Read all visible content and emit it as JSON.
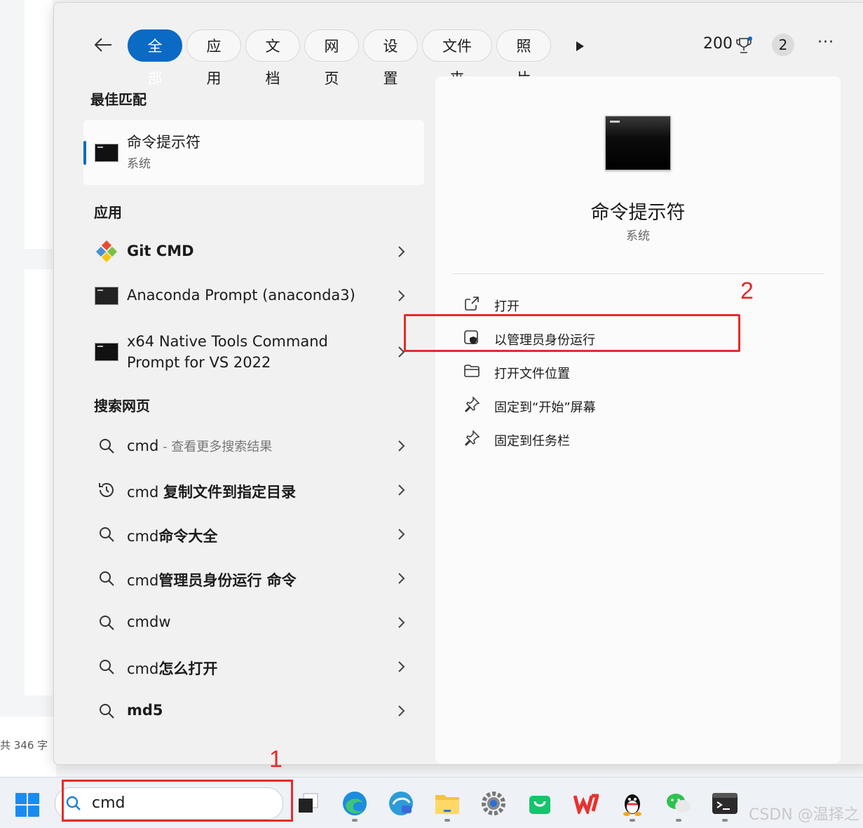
{
  "background": {
    "word_count": "共 346 字"
  },
  "header": {
    "tabs": [
      "全部",
      "应用",
      "文档",
      "网页",
      "设置",
      "文件夹",
      "照片"
    ],
    "points": "200",
    "badge": "2",
    "more": "···"
  },
  "best_match": {
    "section": "最佳匹配",
    "title": "命令提示符",
    "subtitle": "系统"
  },
  "apps": {
    "section": "应用",
    "items": [
      {
        "label": "Git CMD",
        "icon": "git-icon"
      },
      {
        "label": "Anaconda Prompt (anaconda3)",
        "icon": "console-icon"
      },
      {
        "label_line1": "x64 Native Tools Command",
        "label_line2": "Prompt for VS 2022",
        "icon": "console-icon"
      }
    ]
  },
  "web": {
    "section": "搜索网页",
    "items": [
      {
        "label": "cmd",
        "hint": " - 查看更多搜索结果",
        "icon": "search-icon"
      },
      {
        "label": "cmd ",
        "bold": "复制文件到指定目录",
        "icon": "history-icon"
      },
      {
        "label": "cmd",
        "bold": "命令大全",
        "icon": "search-icon"
      },
      {
        "label": "cmd",
        "bold": "管理员身份运行 命令",
        "icon": "search-icon"
      },
      {
        "label": "cmdw",
        "bold": "",
        "icon": "search-icon"
      },
      {
        "label": "cmd",
        "bold": "怎么打开",
        "icon": "search-icon"
      },
      {
        "label": "",
        "bold": "md5",
        "icon": "search-icon"
      }
    ]
  },
  "details": {
    "title": "命令提示符",
    "subtitle": "系统",
    "actions": [
      {
        "label": "打开",
        "icon": "open-external-icon"
      },
      {
        "label": "以管理员身份运行",
        "icon": "shield-icon"
      },
      {
        "label": "打开文件位置",
        "icon": "folder-icon"
      },
      {
        "label": "固定到“开始”屏幕",
        "icon": "pin-icon"
      },
      {
        "label": "固定到任务栏",
        "icon": "pin-icon"
      }
    ]
  },
  "annotations": {
    "one": "1",
    "two": "2",
    "color": "#e52b2b"
  },
  "taskbar": {
    "search_value": "cmd",
    "apps": [
      "task-view",
      "edge",
      "edge-ai",
      "file-explorer",
      "settings",
      "shop",
      "wps",
      "qq",
      "wechat",
      "terminal"
    ]
  },
  "watermark": "CSDN @温择之",
  "colors": {
    "accent": "#0a6ac4",
    "annotation": "#e52b2b"
  }
}
